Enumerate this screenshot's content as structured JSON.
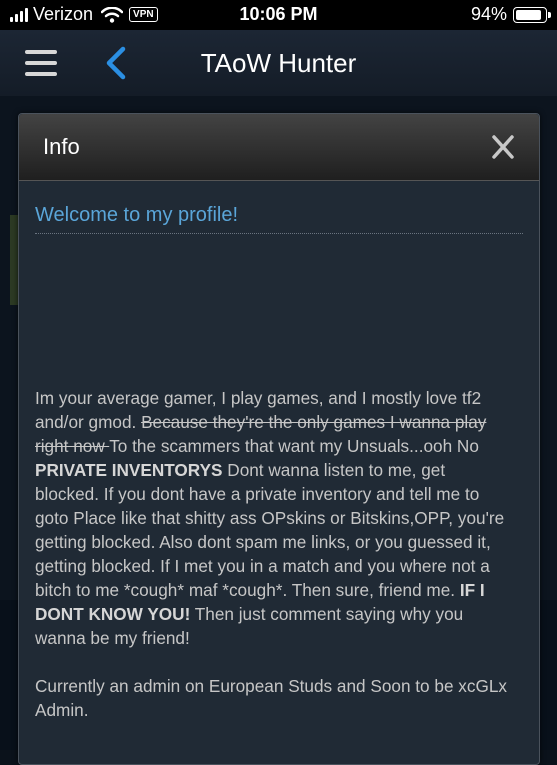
{
  "status_bar": {
    "carrier": "Verizon",
    "vpn_label": "VPN",
    "time": "10:06 PM",
    "battery_percent": "94%",
    "battery_level": 0.94
  },
  "nav": {
    "title": "TAoW Hunter"
  },
  "modal": {
    "title": "Info",
    "welcome": "Welcome to my profile!",
    "bio": {
      "p1_a": "Im your average gamer, I play games, and I mostly love tf2 and/or gmod. ",
      "p1_strike": "Because they're the only games I wanna play right now ",
      "p1_b": "To the scammers that want my Unsuals...ooh No ",
      "p1_bold1": "PRIVATE INVENTORYS",
      "p1_c": " Dont wanna listen to me, get blocked. If you dont have a private inventory and tell me to goto Place like that shitty ass OPskins or Bitskins,OPP, you're getting blocked. Also dont spam me links, or you guessed it, getting blocked. If I met you in a match and you where not a bitch to me *cough* maf *cough*. Then sure, friend me. ",
      "p1_bold2": "IF I DONT KNOW YOU!",
      "p1_d": " Then just comment saying why you wanna be my friend!",
      "p2": "Currently an admin on European Studs and Soon to be xcGLx Admin."
    }
  },
  "colors": {
    "link_blue": "#5aa5d8",
    "back_blue": "#2b8fe3",
    "modal_bg": "#202a35"
  },
  "icons": [
    "signal-icon",
    "wifi-icon",
    "battery-icon",
    "hamburger-icon",
    "back-chevron-icon",
    "close-icon"
  ]
}
